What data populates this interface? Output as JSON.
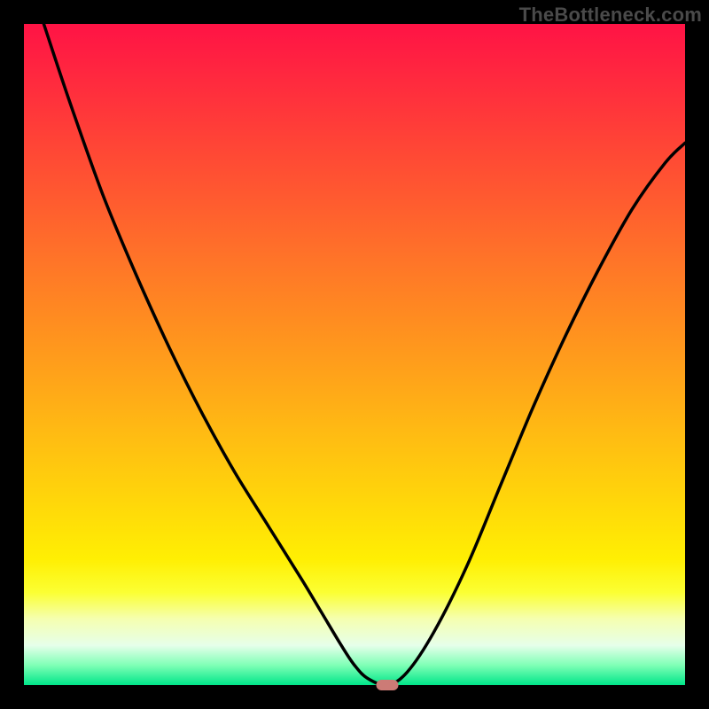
{
  "attribution": "TheBottleneck.com",
  "chart_data": {
    "type": "line",
    "title": "",
    "xlabel": "",
    "ylabel": "",
    "xlim": [
      0,
      100
    ],
    "ylim": [
      0,
      100
    ],
    "x": [
      3,
      7,
      12,
      17,
      22,
      27,
      32,
      37,
      42,
      45,
      48,
      50,
      52,
      55,
      58,
      62,
      67,
      72,
      77,
      82,
      87,
      92,
      97,
      100
    ],
    "values": [
      100,
      88,
      74,
      62,
      51,
      41,
      32,
      24,
      16,
      11,
      6,
      3,
      1,
      0,
      2,
      8,
      18,
      30,
      42,
      53,
      63,
      72,
      79,
      82
    ],
    "marker_x": 55,
    "marker_y": 0,
    "legend": null,
    "grid": false
  },
  "colors": {
    "curve": "#000000",
    "marker": "#cc7b76",
    "gradient_top": "#ff1345",
    "gradient_bottom": "#00e689"
  }
}
